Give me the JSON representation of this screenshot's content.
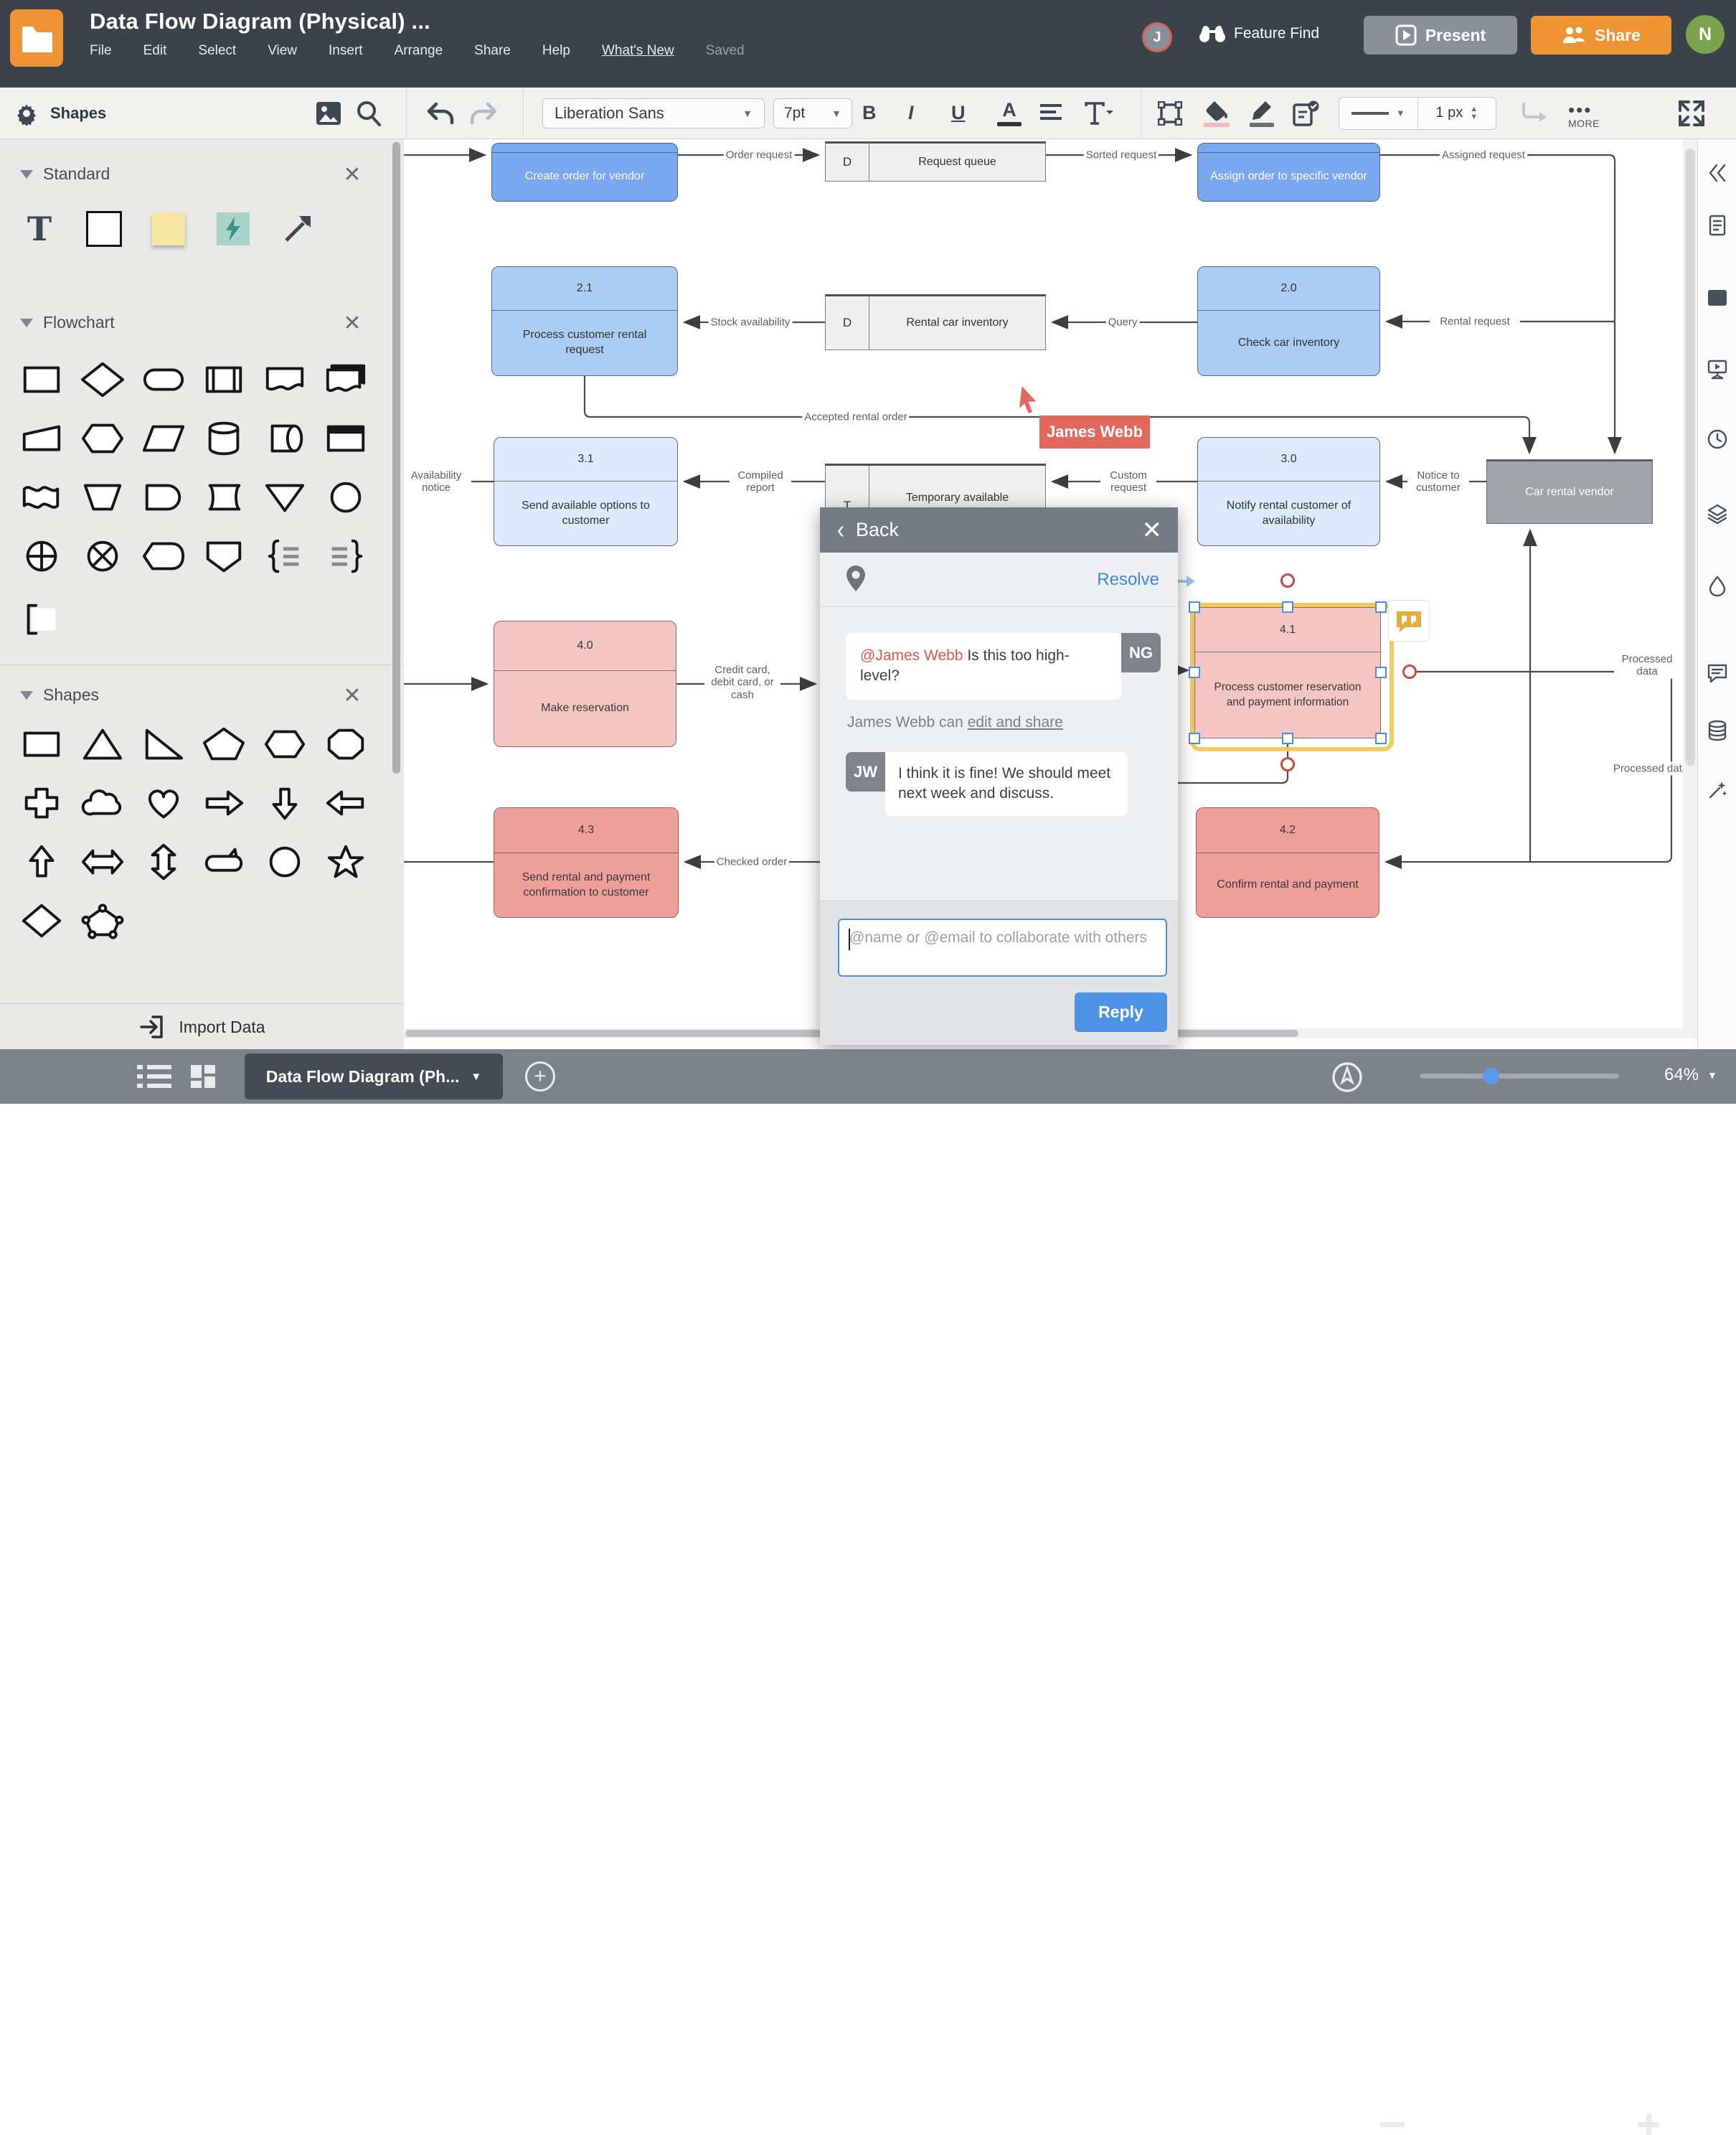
{
  "header": {
    "title": "Data Flow Diagram (Physical) ...",
    "menu": [
      "File",
      "Edit",
      "Select",
      "View",
      "Insert",
      "Arrange",
      "Share",
      "Help",
      "What's New"
    ],
    "saved_status": "Saved",
    "feature_find": "Feature Find",
    "present": "Present",
    "share": "Share",
    "avatar_j": "J",
    "avatar_n": "N"
  },
  "toolbar": {
    "shapes_label": "Shapes",
    "font_name": "Liberation Sans",
    "font_size": "7pt",
    "bold": "B",
    "italic": "I",
    "underline": "U",
    "text_color": "A",
    "line_width": "1 px",
    "more": "MORE"
  },
  "sidebar": {
    "sections": [
      {
        "title": "Standard"
      },
      {
        "title": "Flowchart"
      },
      {
        "title": "Shapes"
      }
    ],
    "import_label": "Import Data"
  },
  "diagram": {
    "nodes": [
      {
        "number": "",
        "label": "Create order for vendor"
      },
      {
        "number": "",
        "label": "Assign order to specific vendor"
      },
      {
        "number": "2.1",
        "label": "Process customer rental request"
      },
      {
        "number": "2.0",
        "label": "Check car inventory"
      },
      {
        "number": "3.1",
        "label": "Send available options to customer"
      },
      {
        "number": "3.0",
        "label": "Notify rental customer of availability"
      },
      {
        "number": "4.0",
        "label": "Make reservation"
      },
      {
        "number": "4.1",
        "label": "Process customer reservation and payment information"
      },
      {
        "number": "4.3",
        "label": "Send rental and payment confirmation to customer"
      },
      {
        "number": "4.2",
        "label": "Confirm rental and payment"
      }
    ],
    "stores": [
      {
        "letter": "D",
        "label": "Request queue"
      },
      {
        "letter": "D",
        "label": "Rental car inventory"
      },
      {
        "letter": "T",
        "label": "Temporary available rental options file"
      }
    ],
    "external_entity": {
      "label": "Car rental vendor"
    },
    "edge_labels": {
      "order_request": "Order request",
      "sorted_request": "Sorted request",
      "assigned_request": "Assigned request",
      "stock_availability": "Stock availability",
      "query": "Query",
      "rental_request": "Rental request",
      "accepted_rental_order": "Accepted rental order",
      "availability_notice": "Availability notice",
      "compiled_report": "Compiled report",
      "custom_request": "Custom request",
      "notice_to_customer": "Notice to customer",
      "credit_card": "Credit card, debit card, or cash",
      "processed_data_1": "Processed data",
      "processed_data_2": "Processed data",
      "checked_order": "Checked order"
    },
    "collaborator_cursor": {
      "name": "James Webb"
    }
  },
  "comment_panel": {
    "back": "Back",
    "resolve": "Resolve",
    "comment": {
      "mention": "@James Webb",
      "text": " Is this too high-level?",
      "avatar": "NG"
    },
    "permission_prefix": "James Webb can ",
    "permission_link": "edit and share",
    "reply": {
      "avatar": "JW",
      "text": "I think it is fine! We should meet next week and discuss."
    },
    "input_placeholder": "@name or @email to collaborate with others",
    "reply_button": "Reply"
  },
  "statusbar": {
    "tab_label": "Data Flow Diagram (Ph...",
    "zoom_level": "64%"
  },
  "colors": {
    "topbar": "#3b424b",
    "accent_orange": "#ee9434",
    "accent_blue": "#4e92e5",
    "process_blue_strong": "#79a8f0",
    "process_blue_mid": "#abccf5",
    "process_blue_light": "#dceafc",
    "process_pink": "#f3c5c3",
    "process_salmon": "#ef9f99",
    "external_gray": "#a1a4a8",
    "cursor_red": "#e2675d",
    "comment_yellow": "#e5ad3c"
  }
}
